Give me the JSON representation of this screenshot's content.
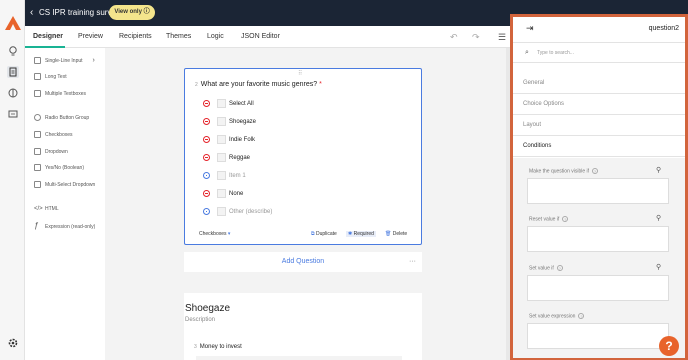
{
  "header": {
    "title": "CS IPR training survey",
    "badge": "View only ⓘ"
  },
  "tabs": [
    "Designer",
    "Preview",
    "Recipients",
    "Themes",
    "Logic",
    "JSON Editor"
  ],
  "toolbox": [
    "Single-Line Input",
    "Long Text",
    "Multiple Textboxes",
    "Radio Button Group",
    "Checkboxes",
    "Dropdown",
    "Yes/No (Boolean)",
    "Multi-Select Dropdown",
    "HTML",
    "Expression (read-only)"
  ],
  "question": {
    "number": "2",
    "title": "What are your favorite music genres?",
    "required_mark": "*",
    "options": [
      "Select All",
      "Shoegaze",
      "Indie Folk",
      "Reggae",
      "Item 1",
      "None",
      "Other (describe)"
    ],
    "type_label": "Checkboxes",
    "actions": {
      "duplicate": "Duplicate",
      "required": "Required",
      "delete": "Delete"
    }
  },
  "add_question": "Add Question",
  "section": {
    "title": "Shoegaze",
    "description": "Description",
    "question_number": "3",
    "question": "Money to invest"
  },
  "panel": {
    "name": "question2",
    "search_placeholder": "Type to search...",
    "sections": [
      "General",
      "Choice Options",
      "Layout",
      "Conditions"
    ],
    "conditions": [
      "Make the question visible if",
      "Reset value if",
      "Set value if",
      "Set value expression"
    ]
  },
  "colors": {
    "header_bg": "#1b2535",
    "accent": "#4a7be0",
    "danger": "#e5242b",
    "highlight": "#d2643c",
    "badge": "#f4e58c",
    "help": "#e8632b"
  }
}
